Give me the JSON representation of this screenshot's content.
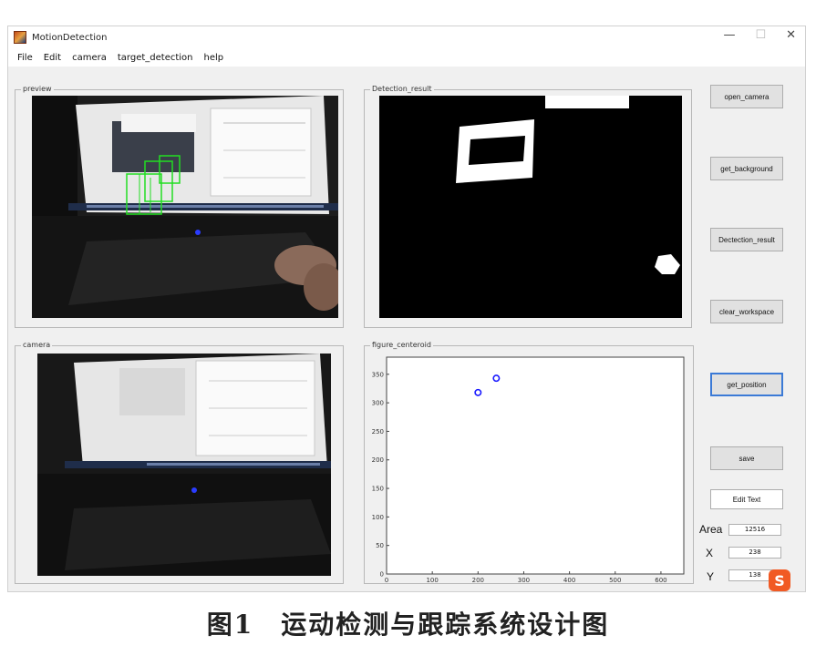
{
  "window": {
    "title": "MotionDetection",
    "controls": {
      "minimize": "—",
      "maximize": "☐",
      "close": "✕"
    }
  },
  "menu": [
    "File",
    "Edit",
    "camera",
    "target_detection",
    "help"
  ],
  "panels": {
    "preview": "preview",
    "detection": "Detection_result",
    "camera": "camera",
    "centroid": "figure_centeroid"
  },
  "buttons": {
    "open_camera": "open_camera",
    "get_background": "get_background",
    "detection_result": "Dectection_result",
    "clear_workspace": "clear_workspace",
    "get_position": "get_position",
    "save": "save",
    "edit_text": "Edit Text"
  },
  "fields": {
    "area_label": "Area",
    "area_value": "12516",
    "x_label": "X",
    "x_value": "238",
    "y_label": "Y",
    "y_value": "138"
  },
  "chart_data": {
    "type": "scatter",
    "title": "",
    "xlabel": "",
    "ylabel": "",
    "xlim": [
      0,
      650
    ],
    "ylim": [
      0,
      380
    ],
    "xticks": [
      0,
      100,
      200,
      300,
      400,
      500,
      600
    ],
    "yticks": [
      0,
      50,
      100,
      150,
      200,
      250,
      300,
      350
    ],
    "points": [
      {
        "x": 200,
        "y": 318
      },
      {
        "x": 240,
        "y": 343
      }
    ],
    "marker_color": "#1a1aff"
  },
  "caption": "图1　运动检测与跟踪系统设计图",
  "watermark": "S"
}
